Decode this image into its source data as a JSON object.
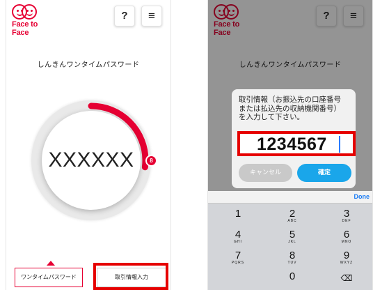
{
  "left_screen": {
    "logo_text": "Face to Face",
    "help_label": "?",
    "menu_label": "≡",
    "subtitle": "しんきんワンタイムパスワード",
    "password": "XXXXXX",
    "timer_seconds": "8",
    "timer_fraction_remaining": 0.27,
    "tabs": [
      "ワンタイムパスワード",
      "取引情報入力"
    ],
    "active_tab": "ワンタイムパスワード"
  },
  "right_screen": {
    "logo_text": "Face to Face",
    "help_label": "?",
    "menu_label": "≡",
    "subtitle": "しんきんワンタイムパスワード",
    "dialog": {
      "message_lines": [
        "取引情報（お振込先の口座番号",
        "または払込先の収納機関番号）",
        "を入力して下さい。"
      ],
      "input_value": "1234567",
      "cancel_label": "キャンセル",
      "ok_label": "確定"
    },
    "keyboard": {
      "done_label": "Done",
      "keys": [
        {
          "num": "1",
          "sub": ""
        },
        {
          "num": "2",
          "sub": "ABC"
        },
        {
          "num": "3",
          "sub": "DEF"
        },
        {
          "num": "4",
          "sub": "GHI"
        },
        {
          "num": "5",
          "sub": "JKL"
        },
        {
          "num": "6",
          "sub": "MNO"
        },
        {
          "num": "7",
          "sub": "PQRS"
        },
        {
          "num": "8",
          "sub": "TUV"
        },
        {
          "num": "9",
          "sub": "WXYZ"
        },
        {
          "num": "",
          "sub": ""
        },
        {
          "num": "0",
          "sub": ""
        },
        {
          "num": "⌫",
          "sub": ""
        }
      ]
    }
  },
  "colors": {
    "brand": "#e60033",
    "highlight": "#e60000",
    "confirm": "#1aa6ea",
    "cancel": "#c9c9c9"
  }
}
